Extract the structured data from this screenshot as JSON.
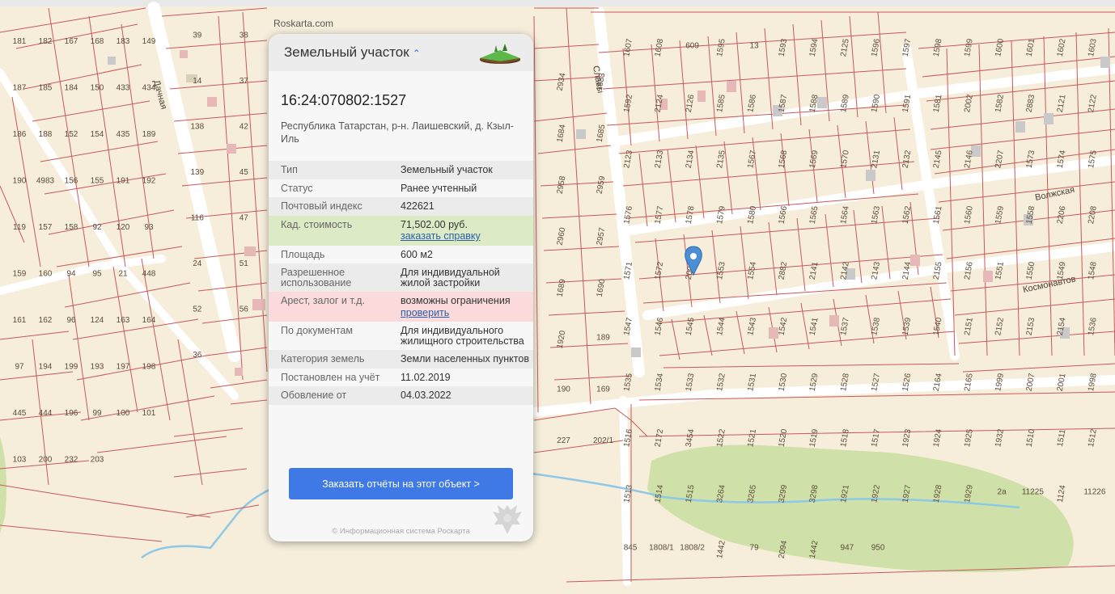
{
  "site_watermark": "Roskarta.com",
  "card": {
    "title": "Земельный участок",
    "chevron": "chevron-up-icon",
    "cadastral_number": "16:24:070802:1527",
    "address": "Республика Татарстан, р-н. Лаишевский, д. Кзыл-Иль",
    "rows": [
      {
        "key": "Тип",
        "value": "Земельный участок"
      },
      {
        "key": "Статус",
        "value": "Ранее учтенный"
      },
      {
        "key": "Почтовый индекс",
        "value": "422621"
      },
      {
        "key": "Кад. стоимость",
        "value": "71,502.00 руб.",
        "link": "заказать справку"
      },
      {
        "key": "Площадь",
        "value": "600 м2"
      },
      {
        "key": "Разрешенное использование",
        "value": "Для индивидуальной жилой застройки"
      },
      {
        "key": "Арест, залог и т.д.",
        "value": "возможны ограничения",
        "link": "проверить"
      },
      {
        "key": "По документам",
        "value": "Для индивидуального жилищного строительства"
      },
      {
        "key": "Категория земель",
        "value": "Земли населенных пунктов"
      },
      {
        "key": "Постановлен на учёт",
        "value": "11.02.2019"
      },
      {
        "key": "Обовление от",
        "value": "04.03.2022"
      }
    ],
    "order_button": "Заказать отчёты на этот объект >",
    "copyright": "© Информационная система Роскарта"
  },
  "map": {
    "street_labels": [
      "Дачная",
      "Славы",
      "Волжская",
      "Космонавтов"
    ],
    "plot_labels": {
      "left": [
        "181",
        "182",
        "167",
        "168",
        "183",
        "149",
        "187",
        "185",
        "184",
        "150",
        "433",
        "434",
        "186",
        "188",
        "152",
        "154",
        "435",
        "189",
        "190",
        "4983",
        "156",
        "155",
        "191",
        "192",
        "119",
        "157",
        "158",
        "92",
        "120",
        "93",
        "159",
        "160",
        "94",
        "95",
        "21",
        "448",
        "161",
        "162",
        "96",
        "124",
        "163",
        "164",
        "97",
        "194",
        "199",
        "193",
        "197",
        "198",
        "445",
        "444",
        "196",
        "99",
        "100",
        "101",
        "103",
        "200",
        "232",
        "203"
      ],
      "center_left": [
        "39",
        "38",
        "14",
        "37",
        "138",
        "42",
        "139",
        "45",
        "116",
        "47",
        "24",
        "51",
        "52",
        "56",
        "36"
      ],
      "center_right": [
        "2934",
        "1683",
        "1684",
        "1685",
        "2958",
        "2959",
        "2960",
        "2957",
        "1689",
        "1690",
        "1920",
        "189",
        "190",
        "169",
        "227",
        "202/1"
      ],
      "right": [
        "1607",
        "1608",
        "609",
        "1595",
        "13",
        "1593",
        "1594",
        "2125",
        "1596",
        "1597",
        "1598",
        "1599",
        "1600",
        "1601",
        "1602",
        "1603",
        "1592",
        "2124",
        "2126",
        "1585",
        "1586",
        "1587",
        "1588",
        "1589",
        "1590",
        "1591",
        "1581",
        "2002",
        "1582",
        "2883",
        "2121",
        "2122",
        "2123",
        "2133",
        "2134",
        "2135",
        "1567",
        "1568",
        "1569",
        "1570",
        "2131",
        "2132",
        "2145",
        "2146",
        "2207",
        "1573",
        "1574",
        "1575",
        "1576",
        "1577",
        "1578",
        "1579",
        "1580",
        "1566",
        "1565",
        "1564",
        "1563",
        "1562",
        "1561",
        "1560",
        "1559",
        "1558",
        "2206",
        "2208",
        "1571",
        "1572",
        "2000",
        "1553",
        "1554",
        "2882",
        "2141",
        "2142",
        "2143",
        "2144",
        "2155",
        "2156",
        "1551",
        "1550",
        "1549",
        "1548",
        "1547",
        "1546",
        "1545",
        "1544",
        "1543",
        "1542",
        "1541",
        "1537",
        "1538",
        "1539",
        "1540",
        "2151",
        "2152",
        "2153",
        "2154",
        "1536",
        "1535",
        "1534",
        "1533",
        "1532",
        "1531",
        "1530",
        "1529",
        "1528",
        "1527",
        "1526",
        "2164",
        "2165",
        "1999",
        "2007",
        "2001",
        "1998",
        "1516",
        "2172",
        "3454",
        "1522",
        "1521",
        "1520",
        "1519",
        "1518",
        "1517",
        "1923",
        "1924",
        "1925",
        "1932",
        "1510",
        "1511",
        "1512",
        "1513",
        "1514",
        "1515",
        "3264",
        "3265",
        "3299",
        "3298",
        "1921",
        "1922",
        "1927",
        "1928",
        "1929",
        "2a",
        "11225",
        "1124",
        "11226",
        "845",
        "1808/1",
        "1808/2",
        "1442",
        "79",
        "2094",
        "1442",
        "947",
        "950"
      ]
    }
  }
}
